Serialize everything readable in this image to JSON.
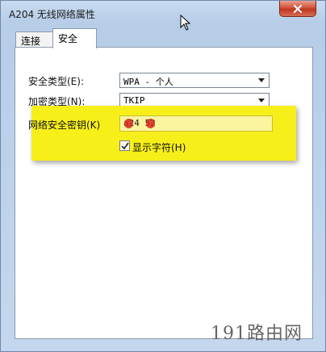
{
  "window": {
    "title": "A204 无线网络属性"
  },
  "tabs": [
    {
      "label": "连接",
      "active": false
    },
    {
      "label": "安全",
      "active": true
    }
  ],
  "security": {
    "type_label": "安全类型(E):",
    "type_value": "WPA - 个人",
    "encryption_label": "加密类型(N):",
    "encryption_value": "TKIP",
    "key_label": "网络安全密钥(K)",
    "key_value": "a24 52",
    "show_chars_label": "显示字符(H)",
    "show_chars_checked": true
  },
  "watermark": "191路由网",
  "colors": {
    "highlight": "#f7ef1a",
    "close_button": "#c0361f",
    "redaction": "#d6281e"
  }
}
